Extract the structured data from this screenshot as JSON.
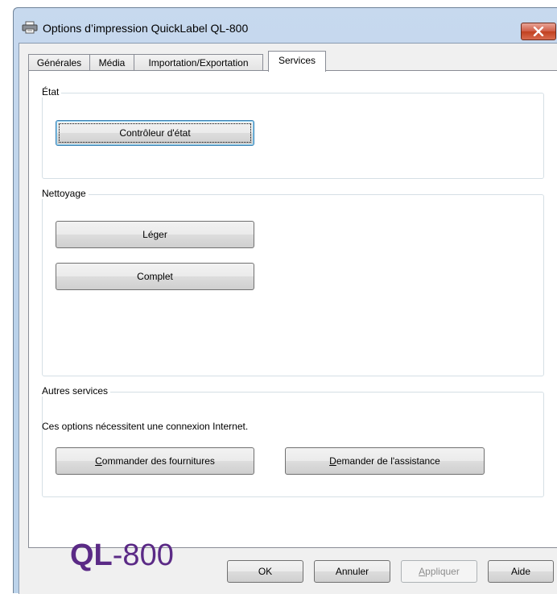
{
  "window": {
    "title": "Options d’impression QuickLabel QL-800"
  },
  "tabs": [
    {
      "label": "Générales"
    },
    {
      "label": "Média"
    },
    {
      "label": "Importation/Exportation"
    },
    {
      "label": "Services",
      "active": true
    }
  ],
  "groups": {
    "etat": {
      "label": "État",
      "button": "Contrôleur d'état"
    },
    "nettoyage": {
      "label": "Nettoyage",
      "light_button": "Léger",
      "full_button": "Complet"
    },
    "autres": {
      "label": "Autres services",
      "description": "Ces options nécessitent une connexion Internet.",
      "order_button": {
        "mnemonic": "C",
        "rest": "ommander des fournitures"
      },
      "support_button": {
        "mnemonic": "D",
        "rest": "emander de l'assistance"
      }
    }
  },
  "logo": {
    "bold": "QL",
    "light": "-800",
    "color": "#5b2a86"
  },
  "footer": {
    "ok": "OK",
    "cancel": "Annuler",
    "apply": {
      "mnemonic": "A",
      "rest": "ppliquer",
      "disabled": true
    },
    "help": "Aide"
  },
  "icons": {
    "app": "printer-icon",
    "close": "close-icon"
  },
  "colors": {
    "accent_close": "#c1401f",
    "frame": "#b9d1ea"
  }
}
